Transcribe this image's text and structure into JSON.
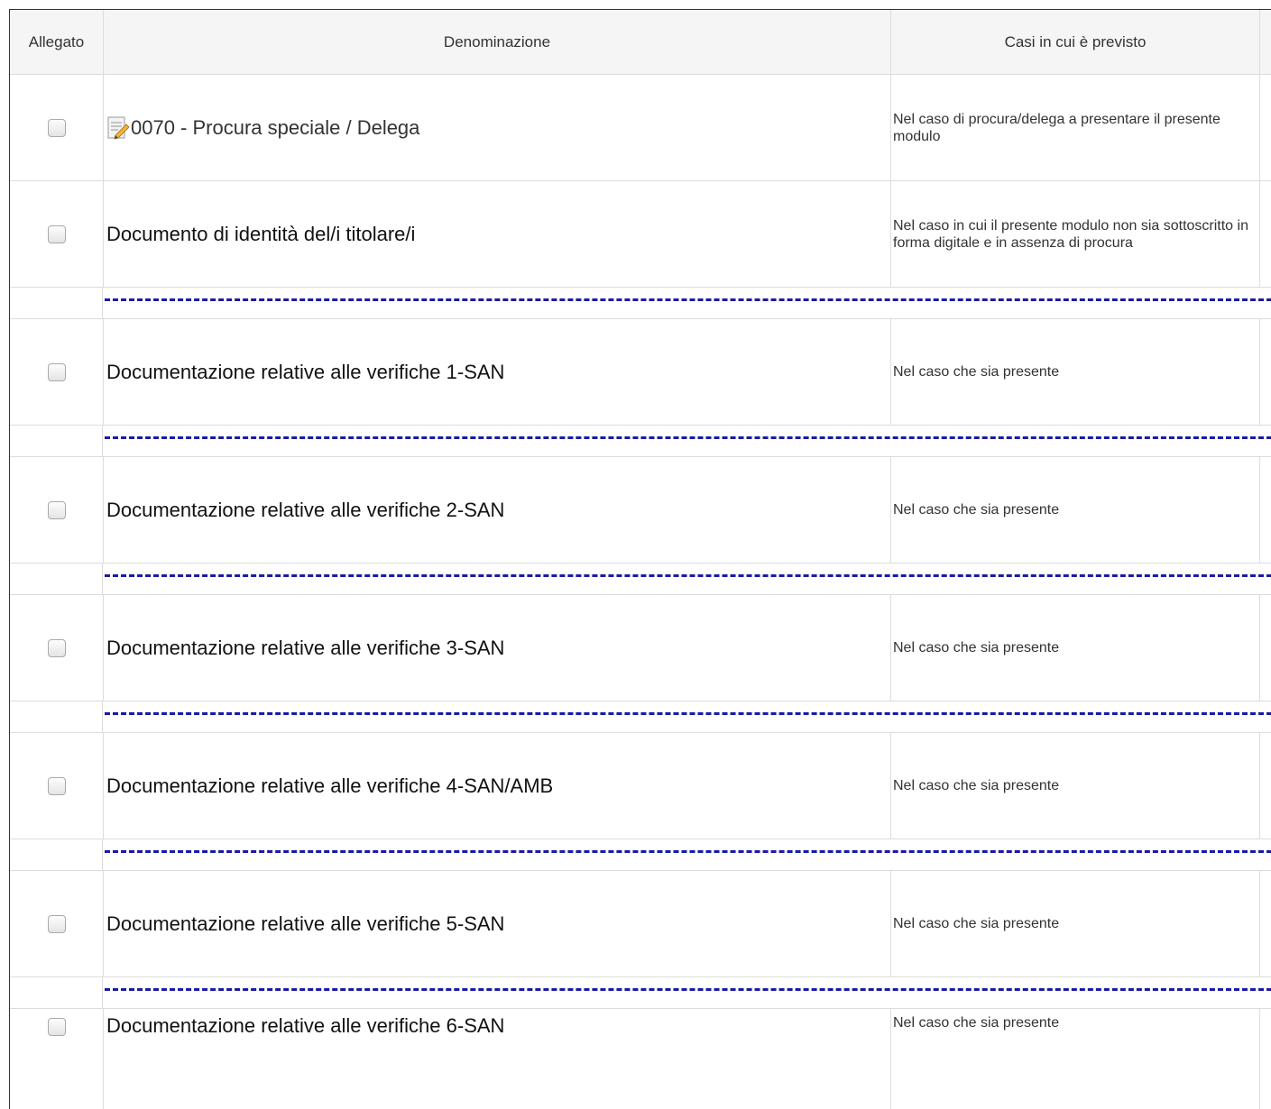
{
  "header": {
    "col_allegato": "Allegato",
    "col_denominazione": "Denominazione",
    "col_casi": "Casi in cui è previsto"
  },
  "rows": [
    {
      "denominazione": "0070 - Procura speciale / Delega",
      "casi": "Nel caso di procura/delega a presentare il presente modulo",
      "icon": "edit-document-icon",
      "checked": false
    },
    {
      "denominazione": "Documento di identità del/i titolare/i",
      "casi": "Nel caso in cui il presente modulo non sia sottoscritto in forma digitale e in assenza di procura",
      "checked": false
    },
    {
      "denominazione": "Documentazione relative alle verifiche 1-SAN",
      "casi": "Nel caso che sia presente",
      "checked": false
    },
    {
      "denominazione": "Documentazione relative alle verifiche 2-SAN",
      "casi": "Nel caso che sia presente",
      "checked": false
    },
    {
      "denominazione": "Documentazione relative alle verifiche 3-SAN",
      "casi": "Nel caso che sia presente",
      "checked": false
    },
    {
      "denominazione": "Documentazione relative alle verifiche 4-SAN/AMB",
      "casi": "Nel caso che sia presente",
      "checked": false
    },
    {
      "denominazione": "Documentazione relative alle verifiche 5-SAN",
      "casi": "Nel caso che sia presente",
      "checked": false
    },
    {
      "denominazione": "Documentazione relative alle verifiche 6-SAN",
      "casi": "Nel caso che sia presente",
      "checked": false
    }
  ],
  "colors": {
    "separator": "#1a1aa6",
    "header_bg": "#f5f5f5",
    "grid": "#dcdcdc"
  }
}
